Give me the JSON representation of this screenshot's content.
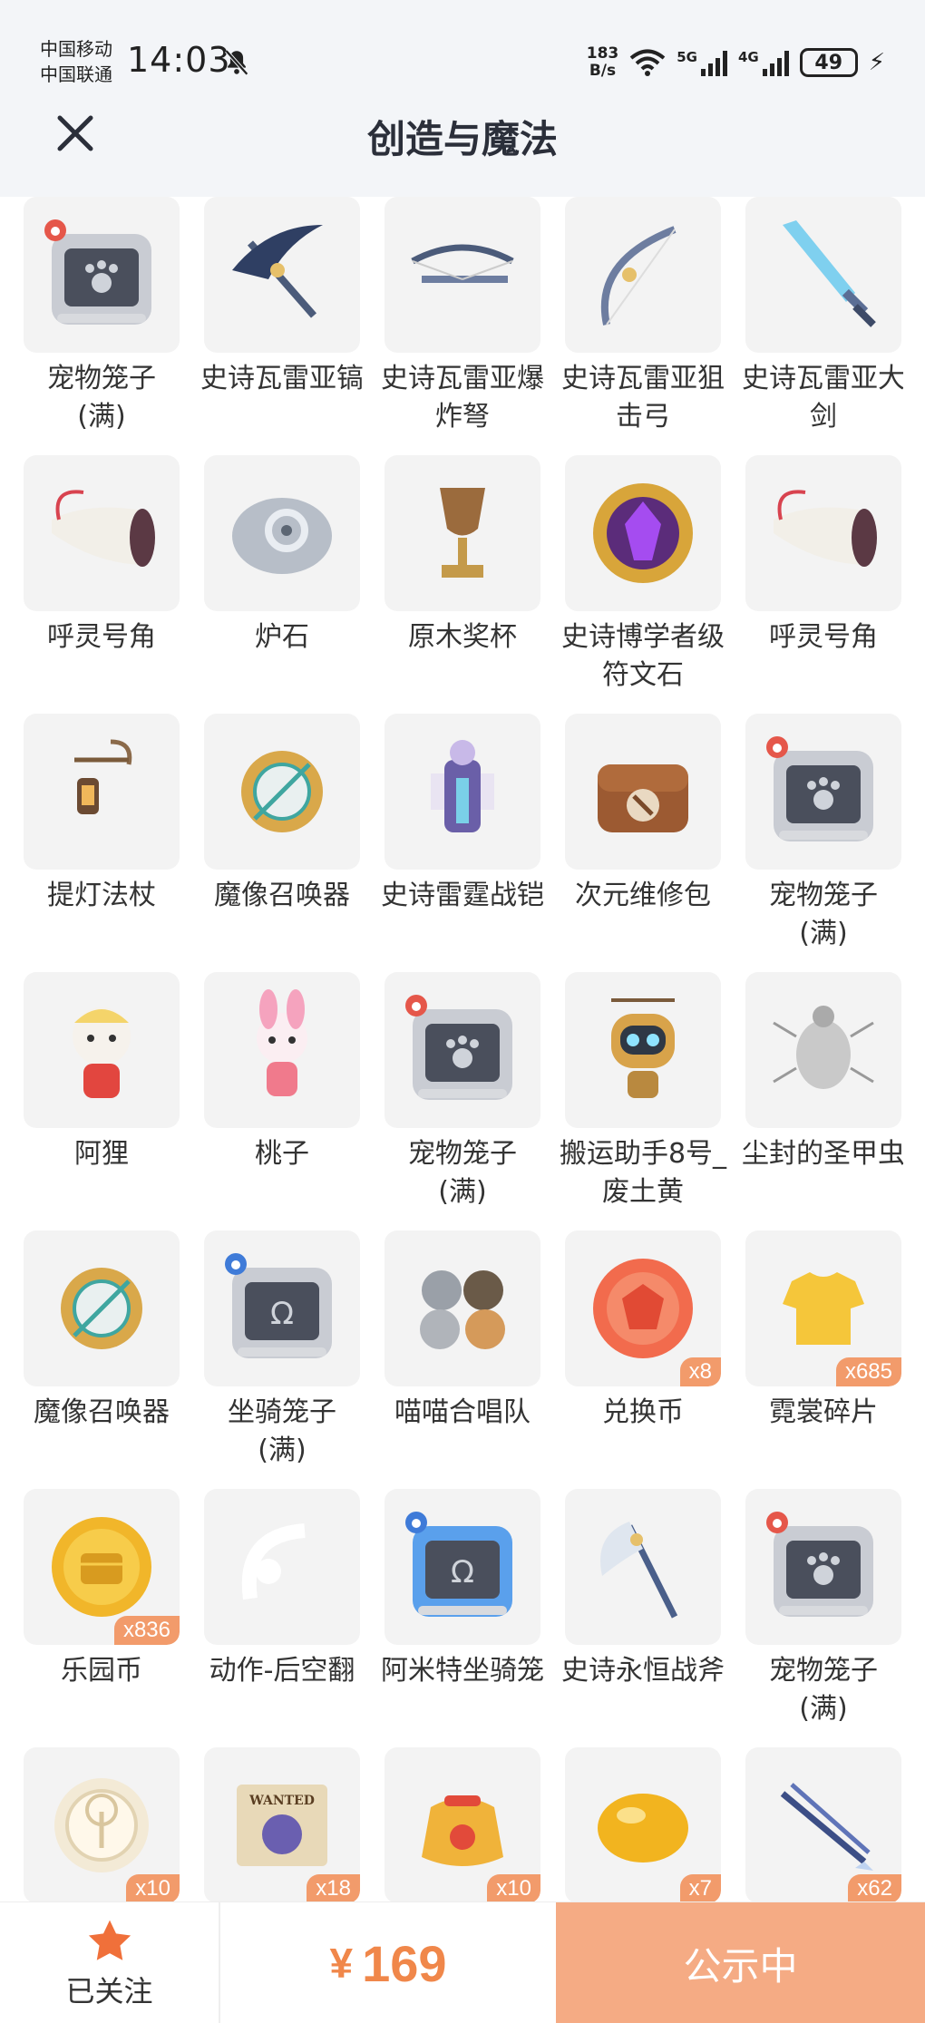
{
  "status_bar": {
    "carrier_1": "中国移动",
    "carrier_2": "中国联通",
    "time": "14:03",
    "net_speed_value": "183",
    "net_speed_unit": "B/s",
    "sig1_label": "5G",
    "sig2_label": "4G",
    "battery": "49"
  },
  "header": {
    "title": "创造与魔法"
  },
  "colors": {
    "accent": "#f0874a",
    "status_button": "#f5ab84",
    "badge": "#f29b6b",
    "tile_bg": "#f3f3f3"
  },
  "items": [
    {
      "name": "宠物笼子\n(满)",
      "icon": "pet-cage-icon",
      "badge": "",
      "corner": "paw"
    },
    {
      "name": "史诗瓦雷亚镐",
      "icon": "epic-pickaxe-icon",
      "badge": ""
    },
    {
      "name": "史诗瓦雷亚爆炸弩",
      "icon": "epic-crossbow-icon",
      "badge": ""
    },
    {
      "name": "史诗瓦雷亚狙击弓",
      "icon": "epic-bow-icon",
      "badge": ""
    },
    {
      "name": "史诗瓦雷亚大剑",
      "icon": "epic-greatsword-icon",
      "badge": ""
    },
    {
      "name": "呼灵号角",
      "icon": "horn-icon",
      "badge": ""
    },
    {
      "name": "炉石",
      "icon": "hearthstone-icon",
      "badge": ""
    },
    {
      "name": "原木奖杯",
      "icon": "wood-trophy-icon",
      "badge": ""
    },
    {
      "name": "史诗博学者级符文石",
      "icon": "rune-stone-icon",
      "badge": ""
    },
    {
      "name": "呼灵号角",
      "icon": "horn-icon",
      "badge": ""
    },
    {
      "name": "提灯法杖",
      "icon": "lantern-staff-icon",
      "badge": ""
    },
    {
      "name": "魔像召唤器",
      "icon": "golem-summoner-icon",
      "badge": ""
    },
    {
      "name": "史诗雷霆战铠",
      "icon": "thunder-armor-icon",
      "badge": ""
    },
    {
      "name": "次元维修包",
      "icon": "repair-kit-icon",
      "badge": ""
    },
    {
      "name": "宠物笼子\n(满)",
      "icon": "pet-cage-icon",
      "badge": "",
      "corner": "paw"
    },
    {
      "name": "阿狸",
      "icon": "ali-pet-icon",
      "badge": ""
    },
    {
      "name": "桃子",
      "icon": "taozi-pet-icon",
      "badge": ""
    },
    {
      "name": "宠物笼子\n(满)",
      "icon": "pet-cage-icon",
      "badge": "",
      "corner": "paw"
    },
    {
      "name": "搬运助手8号_废土黄",
      "icon": "robot-helper-icon",
      "badge": ""
    },
    {
      "name": "尘封的圣甲虫",
      "icon": "scarab-icon",
      "badge": ""
    },
    {
      "name": "魔像召唤器",
      "icon": "golem-summoner-icon",
      "badge": ""
    },
    {
      "name": "坐骑笼子\n(满)",
      "icon": "mount-cage-icon",
      "badge": "",
      "corner": "horseshoe"
    },
    {
      "name": "喵喵合唱队",
      "icon": "cat-choir-icon",
      "badge": ""
    },
    {
      "name": "兑换币",
      "icon": "exchange-coin-icon",
      "badge": "x8"
    },
    {
      "name": "霓裳碎片",
      "icon": "clothing-shard-icon",
      "badge": "x685"
    },
    {
      "name": "乐园币",
      "icon": "park-coin-icon",
      "badge": "x836"
    },
    {
      "name": "动作-后空翻",
      "icon": "backflip-action-icon",
      "badge": ""
    },
    {
      "name": "阿米特坐骑笼",
      "icon": "amit-mount-cage-icon",
      "badge": "",
      "corner": "horseshoe"
    },
    {
      "name": "史诗永恒战斧",
      "icon": "epic-axe-icon",
      "badge": ""
    },
    {
      "name": "宠物笼子\n(满)",
      "icon": "pet-cage-icon",
      "badge": "",
      "corner": "paw"
    },
    {
      "name": "",
      "icon": "tree-emblem-icon",
      "badge": "x10"
    },
    {
      "name": "",
      "icon": "wanted-poster-icon",
      "badge": "x18"
    },
    {
      "name": "",
      "icon": "lucky-bag-icon",
      "badge": "x10"
    },
    {
      "name": "",
      "icon": "gold-bean-icon",
      "badge": "x7"
    },
    {
      "name": "",
      "icon": "arrows-icon",
      "badge": "x62"
    }
  ],
  "bottom_bar": {
    "follow_label": "已关注",
    "currency": "¥",
    "price": "169",
    "status_label": "公示中"
  }
}
